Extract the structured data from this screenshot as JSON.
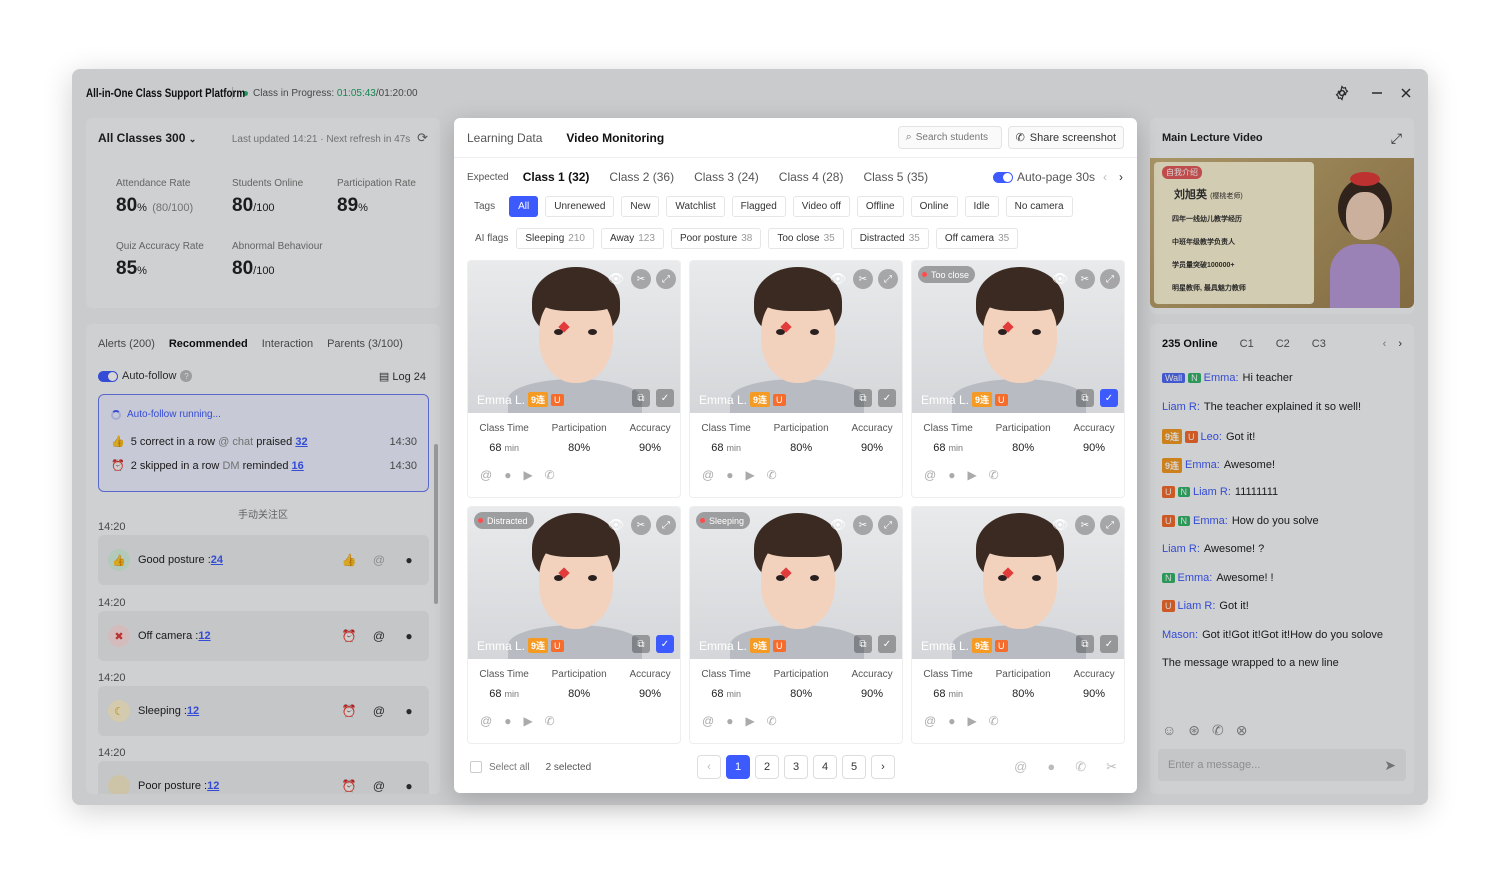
{
  "window": {
    "app_title": "All-in-One Class Support Platform",
    "status_prefix": "Class in Progress: ",
    "elapsed": "01:05:43",
    "total": "/01:20:00"
  },
  "stats": {
    "class_select": "All Classes 300",
    "refresh": "Last updated 14:21 · Next refresh in 47s",
    "items": [
      {
        "label": "Attendance Rate",
        "value": "80",
        "unit": "%",
        "extra": "(80/100)"
      },
      {
        "label": "Students Online",
        "value": "80",
        "unit": "/100",
        "extra": ""
      },
      {
        "label": "Participation Rate",
        "value": "89",
        "unit": "%",
        "extra": ""
      },
      {
        "label": "Quiz Accuracy Rate",
        "value": "85",
        "unit": "%",
        "extra": ""
      },
      {
        "label": "Abnormal Behaviour",
        "value": "80",
        "unit": "/100",
        "extra": ""
      }
    ]
  },
  "alerts": {
    "tabs": [
      "Alerts (200)",
      "Recommended",
      "Interaction",
      "Parents (3/100)"
    ],
    "auto_follow": "Auto-follow",
    "log": "Log 24",
    "running": "Auto-follow running...",
    "rule1": {
      "text": "5 correct in a row",
      "via": "@ chat",
      "action": "praised",
      "count": "32",
      "time": "14:30"
    },
    "rule2": {
      "text": "2 skipped in a row",
      "via": "DM",
      "action": "reminded",
      "count": "16",
      "time": "14:30"
    },
    "manual_zone": "手动关注区",
    "items": [
      {
        "time": "14:20",
        "label": "Good posture :",
        "count": "24"
      },
      {
        "time": "14:20",
        "label": "Off camera :",
        "count": "12"
      },
      {
        "time": "14:20",
        "label": "Sleeping :",
        "count": "12"
      },
      {
        "time": "14:20",
        "label": "Poor posture :",
        "count": "12"
      }
    ]
  },
  "modal": {
    "tabs": [
      "Learning Data",
      "Video Monitoring"
    ],
    "search_placeholder": "Search students",
    "share": "Share screenshot",
    "expected": "Expected",
    "classes": [
      "Class 1 (32)",
      "Class 2 (36)",
      "Class 3 (24)",
      "Class 4 (28)",
      "Class 5 (35)"
    ],
    "auto_page": "Auto-page 30s",
    "tags_label": "Tags",
    "tags": [
      "All",
      "Unrenewed",
      "New",
      "Watchlist",
      "Flagged",
      "Video off",
      "Offline",
      "Online",
      "Idle",
      "No camera"
    ],
    "ai_label": "AI flags",
    "ai_flags": [
      {
        "name": "Sleeping",
        "n": "210"
      },
      {
        "name": "Away",
        "n": "123"
      },
      {
        "name": "Poor posture",
        "n": "38"
      },
      {
        "name": "Too close",
        "n": "35"
      },
      {
        "name": "Distracted",
        "n": "35"
      },
      {
        "name": "Off camera",
        "n": "35"
      }
    ],
    "tile_labels": {
      "time": "Class Time",
      "part": "Participation",
      "acc": "Accuracy"
    },
    "tiles": [
      {
        "name": "Emma L.",
        "streak": "9连",
        "u": "U",
        "badge": "",
        "time": "68",
        "unit": "min",
        "part": "80%",
        "acc": "90%",
        "checked": false
      },
      {
        "name": "Emma L.",
        "streak": "9连",
        "u": "U",
        "badge": "",
        "time": "68",
        "unit": "min",
        "part": "80%",
        "acc": "90%",
        "checked": false
      },
      {
        "name": "Emma L.",
        "streak": "9连",
        "u": "U",
        "badge": "Too close",
        "time": "68",
        "unit": "min",
        "part": "80%",
        "acc": "90%",
        "checked": true
      },
      {
        "name": "Emma L.",
        "streak": "9连",
        "u": "U",
        "badge": "Distracted",
        "time": "68",
        "unit": "min",
        "part": "80%",
        "acc": "90%",
        "checked": true
      },
      {
        "name": "Emma L.",
        "streak": "9连",
        "u": "U",
        "badge": "Sleeping",
        "time": "68",
        "unit": "min",
        "part": "80%",
        "acc": "90%",
        "checked": false
      },
      {
        "name": "Emma L.",
        "streak": "9连",
        "u": "U",
        "badge": "",
        "time": "68",
        "unit": "min",
        "part": "80%",
        "acc": "90%",
        "checked": false
      }
    ],
    "select_all": "Select all",
    "selected": "2 selected",
    "pages": [
      "1",
      "2",
      "3",
      "4",
      "5"
    ],
    "current_page": "1"
  },
  "lecture": {
    "title": "Main Lecture Video",
    "img_tag": "自我介绍",
    "teacher": "刘旭英",
    "teacher_role": "(樱桃老师)",
    "bullets": [
      "四年一线幼儿教学经历",
      "中班年级教学负责人",
      "学员量突破100000+",
      "明星教师, 最具魅力教师"
    ]
  },
  "chat": {
    "online": "235 Online",
    "tabs": [
      "C1",
      "C2",
      "C3"
    ],
    "placeholder": "Enter a message...",
    "messages": [
      {
        "tags": [
          "Wall",
          "N"
        ],
        "name": "Emma:",
        "text": "Hi teacher"
      },
      {
        "tags": [],
        "name": "Liam R:",
        "text": "The teacher explained it so well!"
      },
      {
        "tags": [
          "9连",
          "U"
        ],
        "name": "Leo:",
        "text": "Got it!"
      },
      {
        "tags": [
          "9连"
        ],
        "name": "Emma:",
        "text": "Awesome!"
      },
      {
        "tags": [
          "U",
          "N"
        ],
        "name": "Liam R:",
        "text": "11111111"
      },
      {
        "tags": [
          "U",
          "N"
        ],
        "name": "Emma:",
        "text": "How do you solve"
      },
      {
        "tags": [],
        "name": "Liam R:",
        "text": "Awesome! ?"
      },
      {
        "tags": [
          "N"
        ],
        "name": "Emma:",
        "text": "Awesome! !"
      },
      {
        "tags": [
          "U"
        ],
        "name": "Liam R:",
        "text": "Got it!"
      },
      {
        "tags": [],
        "name": "Mason:",
        "text": "Got it!Got it!Got it!How do you solove"
      },
      {
        "tags": [],
        "name": "",
        "text": "The message wrapped to a new line"
      }
    ]
  },
  "colors": {
    "accent": "#3d5afe",
    "online_green": "#1aa366",
    "streak": "#f59a23"
  }
}
